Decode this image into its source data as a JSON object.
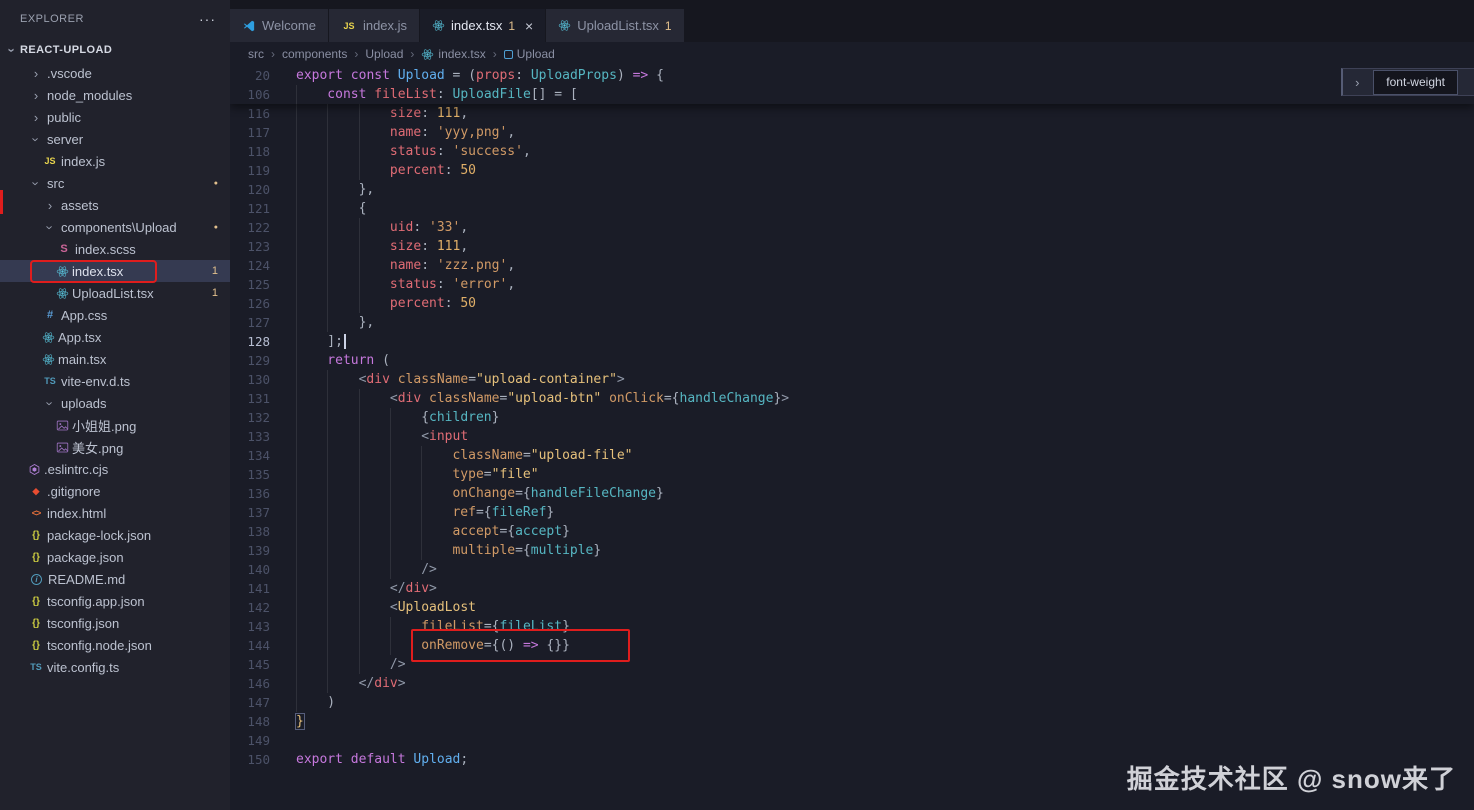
{
  "explorer": {
    "title": "EXPLORER",
    "more_icon": "···",
    "project": "REACT-UPLOAD",
    "items": [
      {
        "label": ".vscode",
        "type": "folder",
        "indent": 1,
        "expanded": false
      },
      {
        "label": "node_modules",
        "type": "folder",
        "indent": 1,
        "expanded": false
      },
      {
        "label": "public",
        "type": "folder",
        "indent": 1,
        "expanded": false
      },
      {
        "label": "server",
        "type": "folder",
        "indent": 1,
        "expanded": true
      },
      {
        "label": "index.js",
        "type": "file",
        "indent": 2,
        "icon": "js-icon"
      },
      {
        "label": "src",
        "type": "folder",
        "indent": 1,
        "expanded": true,
        "badge": "dot"
      },
      {
        "label": "assets",
        "type": "folder",
        "indent": 2,
        "expanded": false
      },
      {
        "label": "components\\Upload",
        "type": "folder",
        "indent": 2,
        "expanded": true,
        "badge": "dot"
      },
      {
        "label": "index.scss",
        "type": "file",
        "indent": 3,
        "icon": "scss-icon"
      },
      {
        "label": "index.tsx",
        "type": "file",
        "indent": 3,
        "icon": "react-icon",
        "selected": true,
        "redbox": true,
        "badge": "1"
      },
      {
        "label": "UploadList.tsx",
        "type": "file",
        "indent": 3,
        "icon": "react-icon",
        "badge": "1"
      },
      {
        "label": "App.css",
        "type": "file",
        "indent": 2,
        "icon": "css-icon"
      },
      {
        "label": "App.tsx",
        "type": "file",
        "indent": 2,
        "icon": "react-icon"
      },
      {
        "label": "main.tsx",
        "type": "file",
        "indent": 2,
        "icon": "react-icon"
      },
      {
        "label": "vite-env.d.ts",
        "type": "file",
        "indent": 2,
        "icon": "ts-icon"
      },
      {
        "label": "uploads",
        "type": "folder",
        "indent": 2,
        "expanded": true
      },
      {
        "label": "小姐姐.png",
        "type": "file",
        "indent": 3,
        "icon": "image-icon"
      },
      {
        "label": "美女.png",
        "type": "file",
        "indent": 3,
        "icon": "image-icon"
      },
      {
        "label": ".eslintrc.cjs",
        "type": "file",
        "indent": 1,
        "icon": "eslint-icon"
      },
      {
        "label": ".gitignore",
        "type": "file",
        "indent": 1,
        "icon": "git-icon"
      },
      {
        "label": "index.html",
        "type": "file",
        "indent": 1,
        "icon": "html-icon"
      },
      {
        "label": "package-lock.json",
        "type": "file",
        "indent": 1,
        "icon": "json-icon"
      },
      {
        "label": "package.json",
        "type": "file",
        "indent": 1,
        "icon": "json-icon"
      },
      {
        "label": "README.md",
        "type": "file",
        "indent": 1,
        "icon": "info-icon"
      },
      {
        "label": "tsconfig.app.json",
        "type": "file",
        "indent": 1,
        "icon": "json-icon"
      },
      {
        "label": "tsconfig.json",
        "type": "file",
        "indent": 1,
        "icon": "json-icon"
      },
      {
        "label": "tsconfig.node.json",
        "type": "file",
        "indent": 1,
        "icon": "json-icon"
      },
      {
        "label": "vite.config.ts",
        "type": "file",
        "indent": 1,
        "icon": "ts-icon"
      }
    ]
  },
  "tabs": [
    {
      "label": "Welcome",
      "icon": "vscode-icon",
      "active": false
    },
    {
      "label": "index.js",
      "icon": "js-icon",
      "active": false
    },
    {
      "label": "index.tsx",
      "icon": "react-icon",
      "active": true,
      "badge": "1",
      "close": "×"
    },
    {
      "label": "UploadList.tsx",
      "icon": "react-icon",
      "active": false,
      "badge": "1"
    }
  ],
  "breadcrumb": {
    "separator": "›",
    "items": [
      {
        "label": "src"
      },
      {
        "label": "components"
      },
      {
        "label": "Upload"
      },
      {
        "label": "index.tsx",
        "icon": "react-icon"
      },
      {
        "label": "Upload",
        "icon": "symbol-icon"
      }
    ]
  },
  "find": {
    "value": "font-weight"
  },
  "editor": {
    "sticky": [
      {
        "n": 20,
        "i": 0,
        "t": [
          [
            "kw",
            "export"
          ],
          [
            "tx",
            " "
          ],
          [
            "kw",
            "const"
          ],
          [
            "tx",
            " "
          ],
          [
            "va",
            "Upload"
          ],
          [
            "tx",
            " = ("
          ],
          [
            "pr",
            "props"
          ],
          [
            "tx",
            ": "
          ],
          [
            "ty",
            "UploadProps"
          ],
          [
            "tx",
            ") "
          ],
          [
            "ar",
            "=>"
          ],
          [
            "tx",
            " {"
          ]
        ]
      },
      {
        "n": 106,
        "i": 4,
        "t": [
          [
            "kw",
            "const"
          ],
          [
            "tx",
            " "
          ],
          [
            "pr",
            "fileList"
          ],
          [
            "tx",
            ": "
          ],
          [
            "ty",
            "UploadFile"
          ],
          [
            "tx",
            "[] = ["
          ]
        ]
      }
    ],
    "lines": [
      {
        "n": 116,
        "i": 12,
        "t": [
          [
            "pr",
            "size"
          ],
          [
            "tx",
            ": "
          ],
          [
            "nu",
            "111"
          ],
          [
            "tx",
            ","
          ]
        ]
      },
      {
        "n": 117,
        "i": 12,
        "t": [
          [
            "pr",
            "name"
          ],
          [
            "tx",
            ": "
          ],
          [
            "st",
            "'yyy,png'"
          ],
          [
            "tx",
            ","
          ]
        ]
      },
      {
        "n": 118,
        "i": 12,
        "t": [
          [
            "pr",
            "status"
          ],
          [
            "tx",
            ": "
          ],
          [
            "st",
            "'success'"
          ],
          [
            "tx",
            ","
          ]
        ]
      },
      {
        "n": 119,
        "i": 12,
        "t": [
          [
            "pr",
            "percent"
          ],
          [
            "tx",
            ": "
          ],
          [
            "nu",
            "50"
          ]
        ]
      },
      {
        "n": 120,
        "i": 8,
        "t": [
          [
            "tx",
            "},"
          ]
        ]
      },
      {
        "n": 121,
        "i": 8,
        "t": [
          [
            "tx",
            "{"
          ]
        ]
      },
      {
        "n": 122,
        "i": 12,
        "t": [
          [
            "pr",
            "uid"
          ],
          [
            "tx",
            ": "
          ],
          [
            "st",
            "'33'"
          ],
          [
            "tx",
            ","
          ]
        ]
      },
      {
        "n": 123,
        "i": 12,
        "t": [
          [
            "pr",
            "size"
          ],
          [
            "tx",
            ": "
          ],
          [
            "nu",
            "111"
          ],
          [
            "tx",
            ","
          ]
        ]
      },
      {
        "n": 124,
        "i": 12,
        "t": [
          [
            "pr",
            "name"
          ],
          [
            "tx",
            ": "
          ],
          [
            "st",
            "'zzz.png'"
          ],
          [
            "tx",
            ","
          ]
        ]
      },
      {
        "n": 125,
        "i": 12,
        "t": [
          [
            "pr",
            "status"
          ],
          [
            "tx",
            ": "
          ],
          [
            "st",
            "'error'"
          ],
          [
            "tx",
            ","
          ]
        ]
      },
      {
        "n": 126,
        "i": 12,
        "t": [
          [
            "pr",
            "percent"
          ],
          [
            "tx",
            ": "
          ],
          [
            "nu",
            "50"
          ]
        ]
      },
      {
        "n": 127,
        "i": 8,
        "t": [
          [
            "tx",
            "},"
          ]
        ]
      },
      {
        "n": 128,
        "i": 4,
        "active": true,
        "t": [
          [
            "tx",
            "];"
          ],
          [
            "cur",
            ""
          ]
        ]
      },
      {
        "n": 129,
        "i": 4,
        "t": [
          [
            "kw",
            "return"
          ],
          [
            "tx",
            " ("
          ]
        ]
      },
      {
        "n": 130,
        "i": 8,
        "t": [
          [
            "br",
            "<"
          ],
          [
            "tg",
            "div"
          ],
          [
            "tx",
            " "
          ],
          [
            "at",
            "className"
          ],
          [
            "tx",
            "="
          ],
          [
            "js",
            "\"upload-container\""
          ],
          [
            "br",
            ">"
          ]
        ]
      },
      {
        "n": 131,
        "i": 12,
        "t": [
          [
            "br",
            "<"
          ],
          [
            "tg",
            "div"
          ],
          [
            "tx",
            " "
          ],
          [
            "at",
            "className"
          ],
          [
            "tx",
            "="
          ],
          [
            "js",
            "\"upload-btn\""
          ],
          [
            "tx",
            " "
          ],
          [
            "at",
            "onClick"
          ],
          [
            "tx",
            "={"
          ],
          [
            "ex",
            "handleChange"
          ],
          [
            "tx",
            "}"
          ],
          [
            "br",
            ">"
          ]
        ]
      },
      {
        "n": 132,
        "i": 16,
        "t": [
          [
            "tx",
            "{"
          ],
          [
            "ex",
            "children"
          ],
          [
            "tx",
            "}"
          ]
        ]
      },
      {
        "n": 133,
        "i": 16,
        "t": [
          [
            "br",
            "<"
          ],
          [
            "tg",
            "input"
          ]
        ]
      },
      {
        "n": 134,
        "i": 20,
        "t": [
          [
            "at",
            "className"
          ],
          [
            "tx",
            "="
          ],
          [
            "js",
            "\"upload-file\""
          ]
        ]
      },
      {
        "n": 135,
        "i": 20,
        "t": [
          [
            "at",
            "type"
          ],
          [
            "tx",
            "="
          ],
          [
            "js",
            "\"file\""
          ]
        ]
      },
      {
        "n": 136,
        "i": 20,
        "t": [
          [
            "at",
            "onChange"
          ],
          [
            "tx",
            "={"
          ],
          [
            "ex",
            "handleFileChange"
          ],
          [
            "tx",
            "}"
          ]
        ]
      },
      {
        "n": 137,
        "i": 20,
        "t": [
          [
            "at",
            "ref"
          ],
          [
            "tx",
            "={"
          ],
          [
            "ex",
            "fileRef"
          ],
          [
            "tx",
            "}"
          ]
        ]
      },
      {
        "n": 138,
        "i": 20,
        "t": [
          [
            "at",
            "accept"
          ],
          [
            "tx",
            "={"
          ],
          [
            "ex",
            "accept"
          ],
          [
            "tx",
            "}"
          ]
        ]
      },
      {
        "n": 139,
        "i": 20,
        "t": [
          [
            "at",
            "multiple"
          ],
          [
            "tx",
            "={"
          ],
          [
            "ex",
            "multiple"
          ],
          [
            "tx",
            "}"
          ]
        ]
      },
      {
        "n": 140,
        "i": 16,
        "t": [
          [
            "br",
            "/>"
          ]
        ]
      },
      {
        "n": 141,
        "i": 12,
        "t": [
          [
            "br",
            "</"
          ],
          [
            "tg",
            "div"
          ],
          [
            "br",
            ">"
          ]
        ]
      },
      {
        "n": 142,
        "i": 12,
        "t": [
          [
            "br",
            "<"
          ],
          [
            "cp",
            "UploadLost"
          ]
        ]
      },
      {
        "n": 143,
        "i": 16,
        "t": [
          [
            "at",
            "fileList"
          ],
          [
            "tx",
            "={"
          ],
          [
            "ex",
            "fileList"
          ],
          [
            "tx",
            "}"
          ]
        ]
      },
      {
        "n": 144,
        "i": 16,
        "box": true,
        "t": [
          [
            "at",
            "onRemove"
          ],
          [
            "tx",
            "={() "
          ],
          [
            "ar",
            "=>"
          ],
          [
            "tx",
            " {}}"
          ]
        ]
      },
      {
        "n": 145,
        "i": 12,
        "t": [
          [
            "br",
            "/>"
          ]
        ]
      },
      {
        "n": 146,
        "i": 8,
        "t": [
          [
            "br",
            "</"
          ],
          [
            "tg",
            "div"
          ],
          [
            "br",
            ">"
          ]
        ]
      },
      {
        "n": 147,
        "i": 4,
        "t": [
          [
            "tx",
            ")"
          ]
        ]
      },
      {
        "n": 148,
        "i": 0,
        "t": [
          [
            "cp mt",
            "}"
          ]
        ]
      },
      {
        "n": 149,
        "i": 0,
        "t": []
      },
      {
        "n": 150,
        "i": 0,
        "t": [
          [
            "kw",
            "export"
          ],
          [
            "tx",
            " "
          ],
          [
            "kw",
            "default"
          ],
          [
            "tx",
            " "
          ],
          [
            "va",
            "Upload"
          ],
          [
            "tx",
            ";"
          ]
        ]
      }
    ]
  },
  "watermark": "掘金技术社区 @ snow来了",
  "colors": {
    "annotation_red": "#df1d1d",
    "modified_badge": "#e2c08d",
    "react_icon": "#58c4dc",
    "editor_background": "#1a1c27",
    "sidebar_background": "#21222c"
  }
}
